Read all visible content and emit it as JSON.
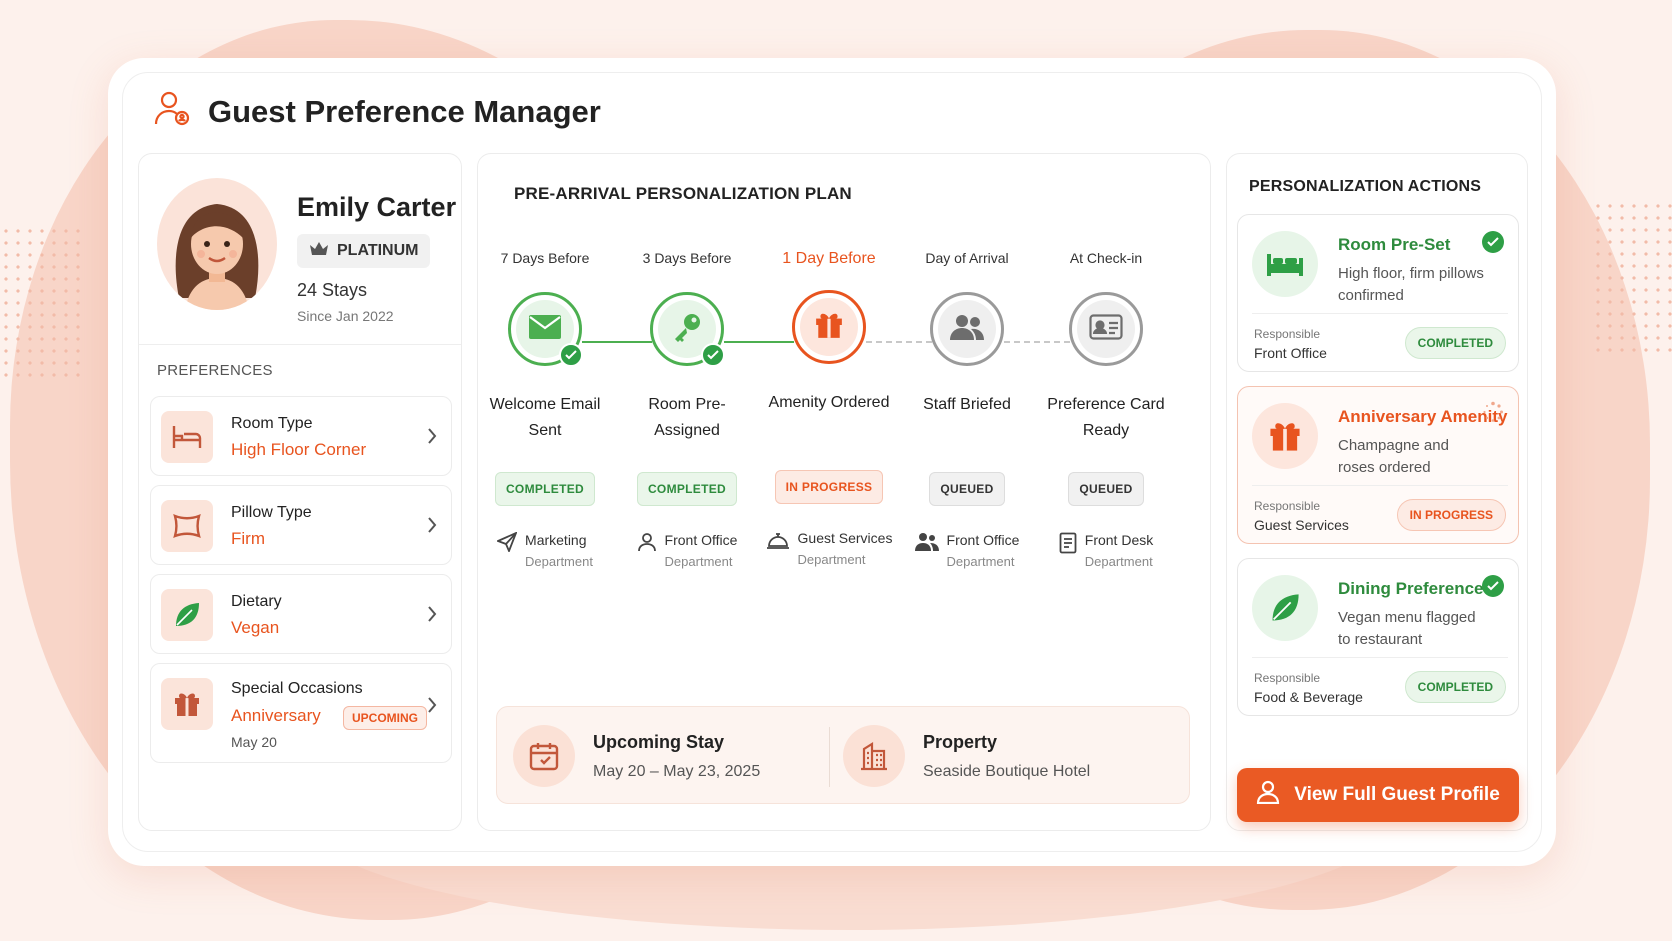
{
  "app": {
    "title": "Guest Preference Manager"
  },
  "guest": {
    "name": "Emily Carter",
    "tier": "PLATINUM",
    "stays": "24 Stays",
    "since": "Since Jan 2022"
  },
  "preferences": {
    "section_label": "PREFERENCES",
    "items": [
      {
        "label": "Room Type",
        "value": "High Floor Corner",
        "icon": "bed-icon"
      },
      {
        "label": "Pillow Type",
        "value": "Firm",
        "icon": "pillow-icon"
      },
      {
        "label": "Dietary",
        "value": "Vegan",
        "icon": "leaf-icon"
      },
      {
        "label": "Special Occasions",
        "value": "Anniversary",
        "badge": "UPCOMING",
        "note": "May 20",
        "icon": "gift-icon"
      }
    ]
  },
  "plan": {
    "title": "PRE-ARRIVAL PERSONALIZATION PLAN",
    "steps": [
      {
        "when": "7 Days Before",
        "label": "Welcome Email Sent",
        "status": "COMPLETED",
        "dept": "Marketing",
        "dept_sub": "Department",
        "icon": "envelope-icon",
        "dept_icon": "paper-plane-icon"
      },
      {
        "when": "3 Days Before",
        "label": "Room Pre-Assigned",
        "status": "COMPLETED",
        "dept": "Front Office",
        "dept_sub": "Department",
        "icon": "key-icon",
        "dept_icon": "person-icon"
      },
      {
        "when": "1 Day Before",
        "label": "Amenity Ordered",
        "status": "IN PROGRESS",
        "dept": "Guest Services",
        "dept_sub": "Department",
        "icon": "gift-icon",
        "dept_icon": "service-bell-icon"
      },
      {
        "when": "Day of Arrival",
        "label": "Staff Briefed",
        "status": "QUEUED",
        "dept": "Front Office",
        "dept_sub": "Department",
        "icon": "users-icon",
        "dept_icon": "group-icon"
      },
      {
        "when": "At Check-in",
        "label": "Preference Card Ready",
        "status": "QUEUED",
        "dept": "Front Desk",
        "dept_sub": "Department",
        "icon": "id-card-icon",
        "dept_icon": "document-icon"
      }
    ],
    "stay": {
      "title": "Upcoming Stay",
      "dates": "May 20 – May 23, 2025"
    },
    "property": {
      "title": "Property",
      "name": "Seaside Boutique Hotel"
    }
  },
  "actions": {
    "title": "PERSONALIZATION ACTIONS",
    "responsible_label": "Responsible",
    "items": [
      {
        "title": "Room Pre-Set",
        "desc": "High floor, firm pillows confirmed",
        "responsible": "Front Office",
        "status": "COMPLETED"
      },
      {
        "title": "Anniversary Amenity",
        "desc": "Champagne and roses ordered",
        "responsible": "Guest Services",
        "status": "IN PROGRESS"
      },
      {
        "title": "Dining Preference",
        "desc": "Vegan menu flagged to restaurant",
        "responsible": "Food & Beverage",
        "status": "COMPLETED"
      }
    ],
    "cta": "View Full Guest Profile"
  },
  "colors": {
    "accent": "#e8541f",
    "success": "#2e9f46",
    "queued": "#9a9a9a"
  }
}
